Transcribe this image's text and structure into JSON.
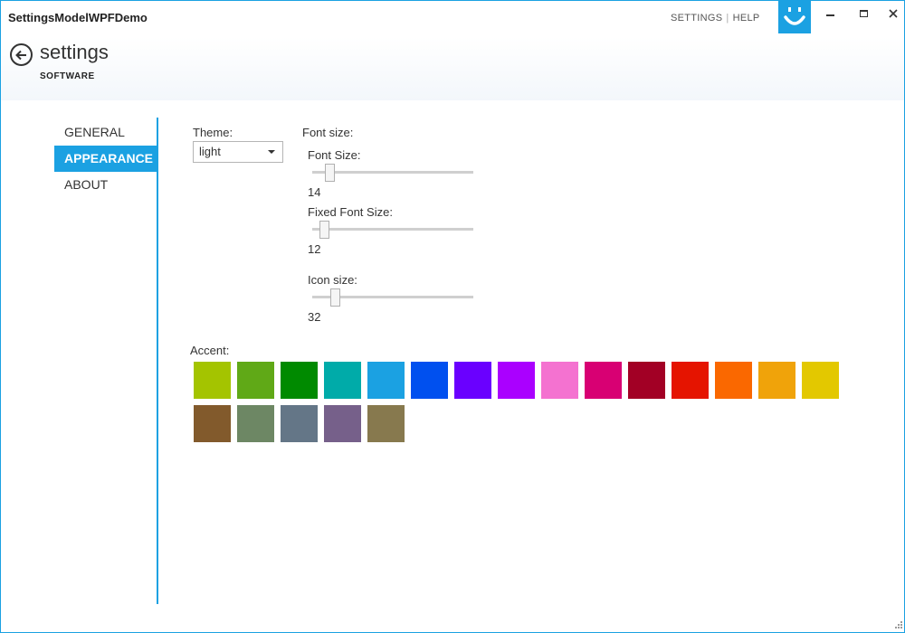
{
  "window": {
    "title": "SettingsModelWPFDemo"
  },
  "top_links": {
    "settings": "SETTINGS",
    "separator": "|",
    "help": "HELP"
  },
  "header": {
    "title": "settings",
    "subtitle": "SOFTWARE"
  },
  "nav": {
    "items": [
      {
        "label": "GENERAL",
        "active": false
      },
      {
        "label": "APPEARANCE",
        "active": true
      },
      {
        "label": "ABOUT",
        "active": false
      }
    ]
  },
  "appearance": {
    "theme_label": "Theme:",
    "theme_value": "light",
    "font_size_group_label": "Font size:",
    "font_size_label": "Font Size:",
    "font_size_value": "14",
    "fixed_font_size_label": "Fixed Font Size:",
    "fixed_font_size_value": "12",
    "icon_size_label": "Icon size:",
    "icon_size_value": "32",
    "accent_label": "Accent:",
    "accent_colors": [
      "#a4c400",
      "#60a917",
      "#008a00",
      "#00aba9",
      "#1ba1e2",
      "#0050ef",
      "#6a00ff",
      "#aa00ff",
      "#f472d0",
      "#d80073",
      "#a20025",
      "#e51400",
      "#fa6800",
      "#f0a30a",
      "#e3c800",
      "#825a2c",
      "#6d8764",
      "#647687",
      "#76608a",
      "#87794e"
    ]
  },
  "colors": {
    "accent": "#1ba1e2"
  }
}
